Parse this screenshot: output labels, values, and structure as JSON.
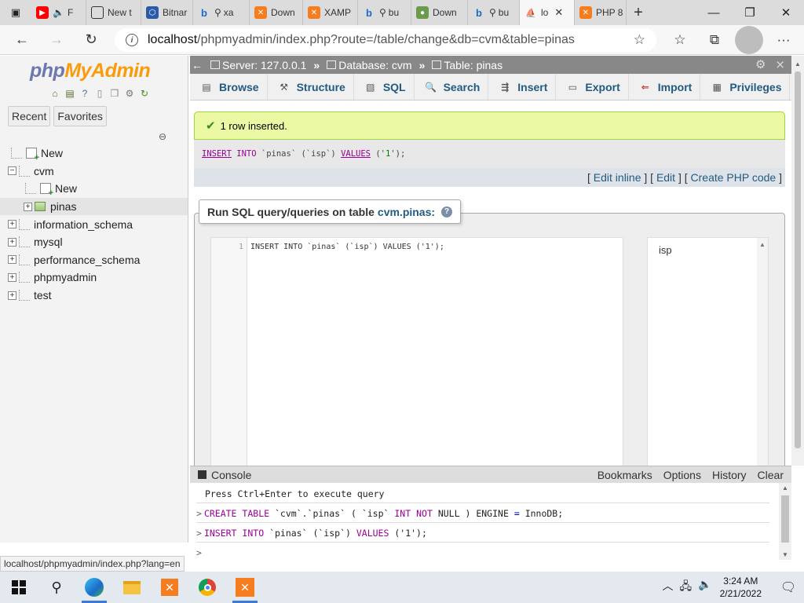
{
  "browser": {
    "tabs": [
      {
        "label": "",
        "icon": "tab-actions-icon"
      },
      {
        "label": "F",
        "icon": "youtube-icon",
        "color": "#ff0000"
      },
      {
        "label": "New t",
        "icon": "new-tab-page-icon"
      },
      {
        "label": "Bitnar",
        "icon": "bitnami-icon"
      },
      {
        "label": "xa",
        "icon": "bing-search-icon"
      },
      {
        "label": "Down",
        "icon": "xampp-icon"
      },
      {
        "label": "XAMP",
        "icon": "xampp-icon"
      },
      {
        "label": "bu",
        "icon": "bing-search-icon"
      },
      {
        "label": "Down",
        "icon": "download-site-icon"
      },
      {
        "label": "bu",
        "icon": "bing-search-icon"
      },
      {
        "label": "lo",
        "icon": "phpmyadmin-icon",
        "active": true
      },
      {
        "label": "PHP 8",
        "icon": "xampp-icon"
      }
    ],
    "url_host": "localhost",
    "url_path": "/phpmyadmin/index.php?route=/table/change&db=cvm&table=pinas"
  },
  "logo": {
    "php": "php",
    "mya": "MyAdmin"
  },
  "nav": {
    "recent": "Recent",
    "favorites": "Favorites",
    "tree": {
      "new_top": "New",
      "cvm": "cvm",
      "cvm_new": "New",
      "pinas": "pinas",
      "information_schema": "information_schema",
      "mysql": "mysql",
      "performance_schema": "performance_schema",
      "phpmyadmin": "phpmyadmin",
      "test": "test"
    }
  },
  "breadcrumb": {
    "server": "Server: 127.0.0.1",
    "database": "Database: cvm",
    "table": "Table: pinas"
  },
  "menu": {
    "browse": "Browse",
    "structure": "Structure",
    "sql": "SQL",
    "search": "Search",
    "insert": "Insert",
    "export": "Export",
    "import": "Import",
    "privileges": "Privileges"
  },
  "main": {
    "success": "1 row inserted.",
    "sql_stmt": {
      "insert": "INSERT",
      "into": "INTO",
      "table": "`pinas`",
      "cols": "(`isp`)",
      "values": "VALUES",
      "vals_open": "(",
      "val": "'1'",
      "vals_close": ");"
    },
    "actions": {
      "edit_inline": "Edit inline",
      "edit": "Edit",
      "create_php": "Create PHP code"
    },
    "legend_label": "Run SQL query/queries on table",
    "legend_table": "cvm.pinas:",
    "editor_line_no": "1",
    "editor_code": "INSERT INTO `pinas` (`isp`) VALUES ('1');",
    "column": "isp"
  },
  "console": {
    "title": "Console",
    "bookmarks": "Bookmarks",
    "options": "Options",
    "history": "History",
    "clear": "Clear",
    "hint": "Press Ctrl+Enter to execute query",
    "q1": {
      "create": "CREATE",
      "table_kw": "TABLE",
      "ident": "`cvm`.`pinas`",
      "open": "(",
      "col": "`isp`",
      "int": "INT",
      "not": "NOT",
      "null": "NULL",
      "close": ")",
      "engine": "ENGINE",
      "eq": "=",
      "innodb": "InnoDB;"
    },
    "q2": {
      "insert": "INSERT",
      "into": "INTO",
      "rest": "`pinas` (`isp`)",
      "values": "VALUES",
      "val": "('1');"
    }
  },
  "status_url": "localhost/phpmyadmin/index.php?lang=en",
  "taskbar": {
    "time": "3:24 AM",
    "date": "2/21/2022"
  }
}
